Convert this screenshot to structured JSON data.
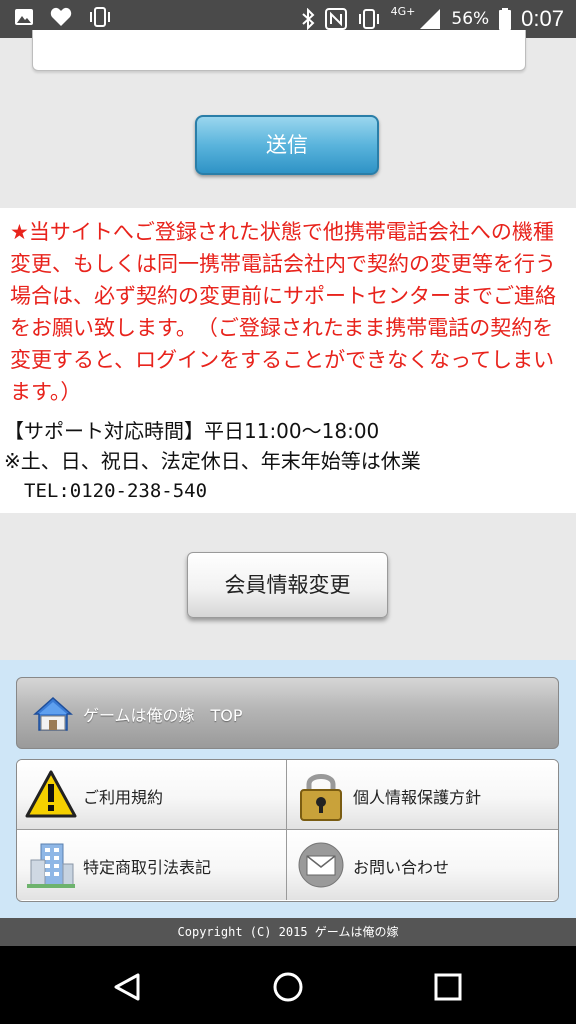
{
  "status_bar": {
    "icons_left": [
      "image-icon",
      "heart-icon",
      "vibrate-icon"
    ],
    "icons_right": [
      "bluetooth-icon",
      "nfc-icon",
      "vibrate-icon",
      "signal-icon",
      "battery-icon"
    ],
    "network": "4G+",
    "battery": "56%",
    "time": "0:07"
  },
  "form": {
    "send_label": "送信"
  },
  "notice": {
    "text": "★当サイトへご登録された状態で他携帯電話会社への機種変更、もしくは同一携帯電話会社内で契約の変更等を行う場合は、必ず契約の変更前にサポートセンターまでご連絡をお願い致します。　（ご登録されたまま携帯電話の契約を変更すると、ログインをすることができなくなってしまいます。）",
    "support_hours": "【サポート対応時間】平日11:00〜18:00",
    "closed_days": "※土、日、祝日、法定休日、年末年始等は休業",
    "tel": "TEL:0120-238-540"
  },
  "member_button": {
    "label": "会員情報変更"
  },
  "footer_menu": {
    "top_label": "ゲームは俺の嫁　TOP",
    "items": [
      {
        "label": "ご利用規約",
        "icon": "warning-icon"
      },
      {
        "label": "個人情報保護方針",
        "icon": "padlock-icon"
      },
      {
        "label": "特定商取引法表記",
        "icon": "building-icon"
      },
      {
        "label": "お問い合わせ",
        "icon": "mail-icon"
      }
    ]
  },
  "copyright": "Copyright (C) 2015 ゲームは俺の嫁",
  "colors": {
    "notice_red": "#e8231c",
    "send_blue": "#2f93c6",
    "footer_bg": "#cfe6f7"
  }
}
